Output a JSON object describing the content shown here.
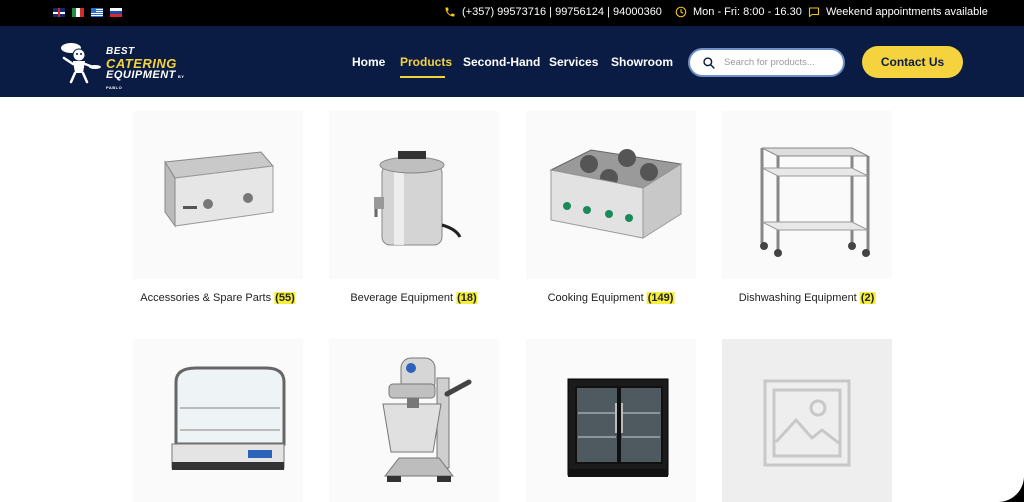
{
  "topbar": {
    "flags": [
      "english-flag",
      "italian-flag",
      "greek-flag",
      "russian-flag"
    ],
    "phone": "(+357)  99573716  |  99756124  |  94000360",
    "hours": "Mon - Fri: 8:00 - 16.30",
    "weekend": "Weekend appointments available"
  },
  "header": {
    "logo": {
      "best": "BEST",
      "catering": "CATERING",
      "equipment": "EQUIPMENT",
      "by": "BY PABLO"
    },
    "nav": [
      {
        "label": "Home",
        "active": false
      },
      {
        "label": "Products",
        "active": true
      },
      {
        "label": "Second-Hand",
        "active": false
      },
      {
        "label": "Services",
        "active": false
      },
      {
        "label": "Showroom",
        "active": false
      }
    ],
    "search_placeholder": "Search for products...",
    "contact_label": "Contact Us"
  },
  "categories": [
    {
      "name": "Accessories & Spare Parts",
      "count": "(55)",
      "image": "griddle"
    },
    {
      "name": "Beverage Equipment",
      "count": "(18)",
      "image": "water-boiler"
    },
    {
      "name": "Cooking Equipment",
      "count": "(149)",
      "image": "gas-stove"
    },
    {
      "name": "Dishwashing Equipment",
      "count": "(2)",
      "image": "trolley"
    },
    {
      "name": "",
      "count": "",
      "image": "display-fridge"
    },
    {
      "name": "",
      "count": "",
      "image": "planetary-mixer"
    },
    {
      "name": "",
      "count": "",
      "image": "bottle-cooler"
    },
    {
      "name": "",
      "count": "",
      "image": "placeholder"
    }
  ],
  "colors": {
    "topbar_bg": "#000000",
    "header_bg": "#0a1c44",
    "accent": "#f5d33e",
    "count_highlight": "#f5ee3a"
  }
}
